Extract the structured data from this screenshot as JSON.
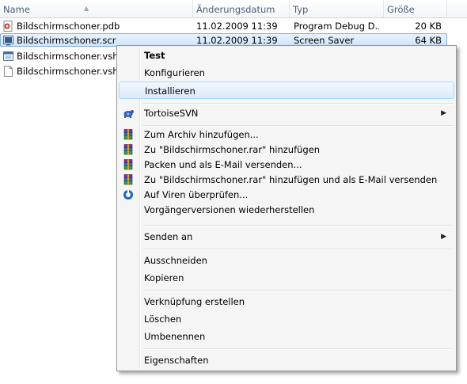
{
  "columns": {
    "name": "Name",
    "date": "Änderungsdatum",
    "type": "Typ",
    "size": "Größe"
  },
  "files": [
    {
      "name": "Bildschirmschoner.pdb",
      "date": "11.02.2009 11:39",
      "type": "Program Debug D...",
      "size": "20 KB",
      "icon": "pdb-file-icon"
    },
    {
      "name": "Bildschirmschoner.scr",
      "date": "11.02.2009 11:39",
      "type": "Screen Saver",
      "size": "64 KB",
      "icon": "screensaver-file-icon",
      "selected": true
    },
    {
      "name": "Bildschirmschoner.vshost.exe",
      "date": "",
      "type": "",
      "size": "",
      "icon": "exe-file-icon"
    },
    {
      "name": "Bildschirmschoner.vshost.exe.manifest",
      "date": "",
      "type": "",
      "size": "",
      "icon": "document-file-icon"
    }
  ],
  "menu": {
    "test": "Test",
    "konfigurieren": "Konfigurieren",
    "installieren": "Installieren",
    "tortoise": "TortoiseSVN",
    "archiv": "Zum Archiv hinzufügen...",
    "rar": "Zu \"Bildschirmschoner.rar\" hinzufügen",
    "packen_mail": "Packen und als E-Mail versenden...",
    "rar_mail": "Zu \"Bildschirmschoner.rar\" hinzufügen und als E-Mail versenden",
    "viren": "Auf Viren überprüfen...",
    "vorgaenger": "Vorgängerversionen wiederherstellen",
    "senden": "Senden an",
    "ausschneiden": "Ausschneiden",
    "kopieren": "Kopieren",
    "verknuepfung": "Verknüpfung erstellen",
    "loeschen": "Löschen",
    "umbenennen": "Umbenennen",
    "eigenschaften": "Eigenschaften"
  },
  "colors": {
    "selection": "#cfe5fb",
    "selection_border": "#84acdd",
    "menu_bg": "#f5f5f5",
    "hover_border": "#a8d8fb"
  }
}
